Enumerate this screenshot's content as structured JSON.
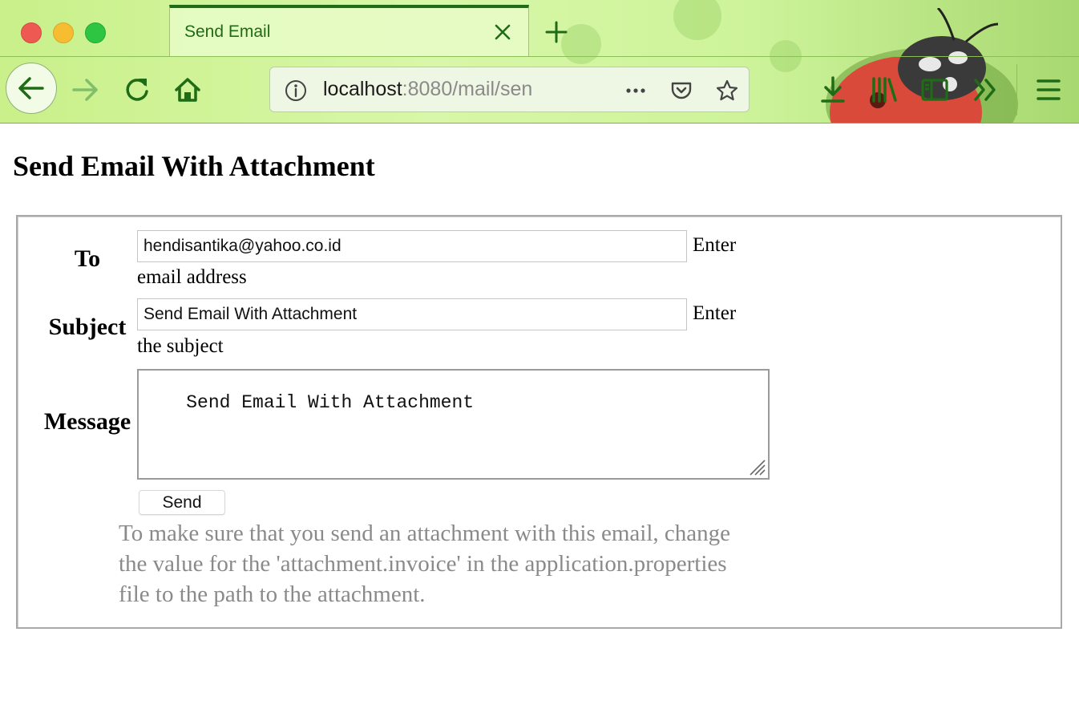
{
  "browser": {
    "tab_title": "Send Email",
    "url_host": "localhost",
    "url_rest": ":8080/mail/sen"
  },
  "page": {
    "title": "Send Email With Attachment"
  },
  "form": {
    "to": {
      "label": "To",
      "value": "hendisantika@yahoo.co.id",
      "hint_first": "Enter",
      "hint_second": "email address"
    },
    "subject": {
      "label": "Subject",
      "value": "Send Email With Attachment",
      "hint_first": "Enter",
      "hint_second": "the subject"
    },
    "message": {
      "label": "Message",
      "value": "Send Email With Attachment"
    },
    "send_label": "Send",
    "note": "To make sure that you send an attachment with this email, change the value for the 'attachment.invoice' in the application.properties file to the path to the attachment."
  },
  "icons": {
    "back": "back-arrow-icon",
    "forward": "forward-arrow-icon",
    "reload": "reload-icon",
    "home": "home-icon",
    "info": "info-icon",
    "more": "more-dots-icon",
    "pocket": "pocket-icon",
    "bookmark": "star-icon",
    "downloads": "download-icon",
    "library": "library-icon",
    "sidebar": "sidebar-icon",
    "overflow": "chevrons-right-icon",
    "menu": "hamburger-menu-icon"
  },
  "colors": {
    "chrome_green": "#1f6b16",
    "theme_light": "#d8f7a8",
    "note_gray": "#8a8a8a"
  }
}
